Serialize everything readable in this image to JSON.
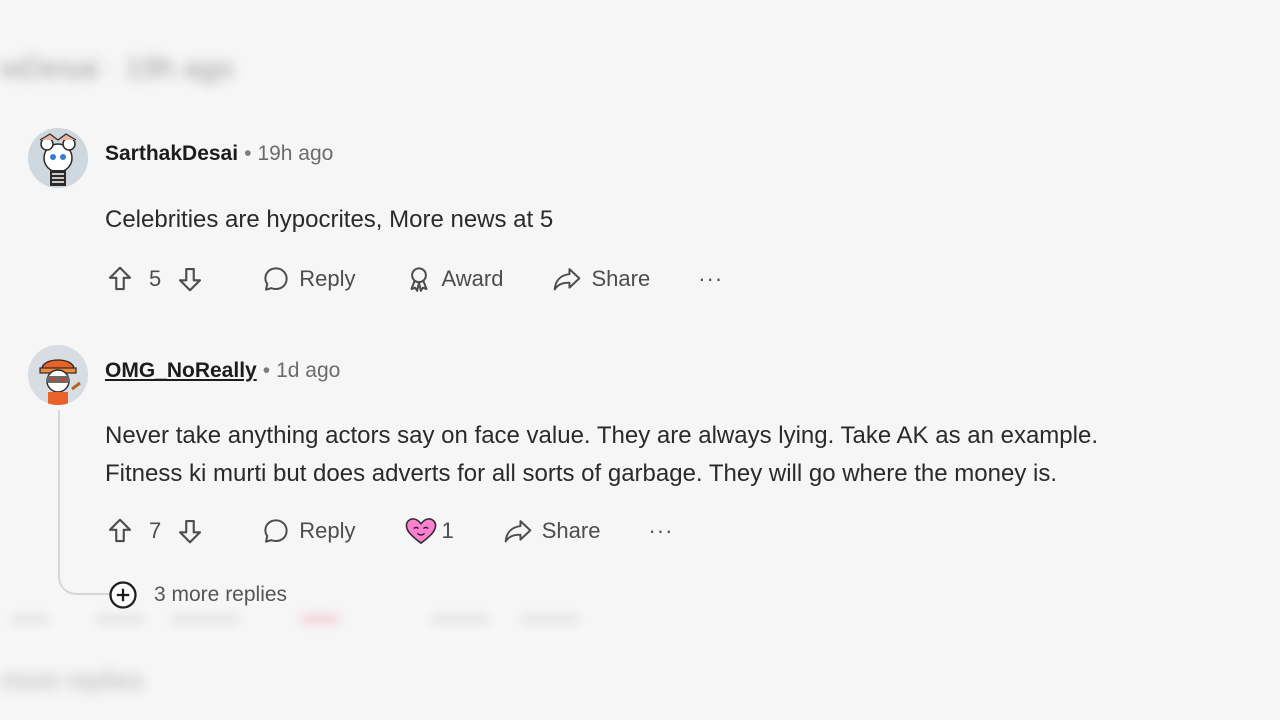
{
  "blurred_top": "wDesai · 19h ago",
  "blurred_bottom": "more replies",
  "comments": [
    {
      "username": "SarthakDesai",
      "separator": "•",
      "time": "19h ago",
      "text_lines": [
        "Celebrities are hypocrites, More news at 5"
      ],
      "votes": "5",
      "reply_label": "Reply",
      "award_label": "Award",
      "share_label": "Share",
      "more_label": "···"
    },
    {
      "username": "OMG_NoReally",
      "separator": "•",
      "time": "1d ago",
      "text_lines": [
        "Never take anything actors say on face value. They are always lying. Take AK as an example.",
        "Fitness ki murti but does adverts for all sorts of garbage. They will go where the money is."
      ],
      "votes": "7",
      "reply_label": "Reply",
      "award_count": "1",
      "share_label": "Share",
      "more_label": "···"
    }
  ],
  "more_replies_label": "3 more replies",
  "colors": {
    "background": "#f6f6f7",
    "text": "#1c1c1c",
    "muted": "#6b6b6b",
    "award_pink": "#ff7fd1"
  }
}
